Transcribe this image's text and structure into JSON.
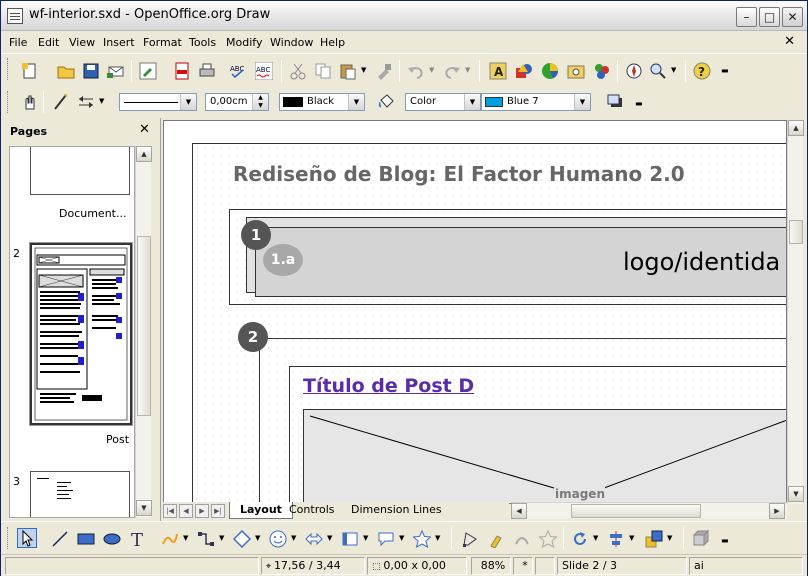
{
  "window": {
    "title": "wf-interior.sxd - OpenOffice.org Draw"
  },
  "menu": [
    "File",
    "Edit",
    "View",
    "Insert",
    "Format",
    "Tools",
    "Modify",
    "Window",
    "Help"
  ],
  "line_toolbar": {
    "line_width": "0,00cm",
    "line_color": "Black",
    "area_style": "Color",
    "area_color": "Blue 7",
    "area_color_hex": "#00a0e0"
  },
  "pages_panel": {
    "title": "Pages",
    "pages": [
      {
        "number": "",
        "name": "Document..."
      },
      {
        "number": "2",
        "name": "Post"
      },
      {
        "number": "3",
        "name": ""
      }
    ]
  },
  "document": {
    "heading": "Rediseño de Blog: El Factor Humano 2.0",
    "section1_badge": "1",
    "section1a_badge": "1.a",
    "logo_label": "logo/identida",
    "section2_badge": "2",
    "post_title": "Título de Post D",
    "image_label": "imagen"
  },
  "tabs": [
    "Layout",
    "Controls",
    "Dimension Lines"
  ],
  "status": {
    "position": "17,56 / 3,44",
    "size": "0,00 x 0,00",
    "zoom": "88%",
    "modified": "*",
    "slide": "Slide 2 / 3",
    "style": "ai"
  },
  "colors": {
    "accent_purple": "#5a2ca8",
    "badge_gray": "#555555",
    "badge_light": "#a8a8a8"
  }
}
